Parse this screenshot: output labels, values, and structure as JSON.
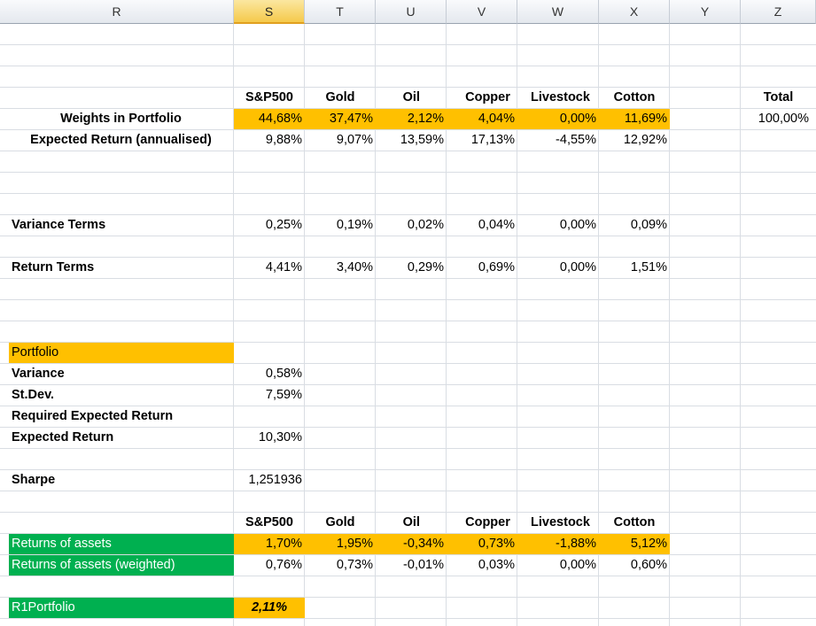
{
  "columns": [
    "R",
    "S",
    "T",
    "U",
    "V",
    "W",
    "X",
    "Y",
    "Z"
  ],
  "selected_column": "S",
  "assets_header": [
    "S&P500",
    "Gold",
    "Oil",
    "Copper",
    "Livestock",
    "Cotton"
  ],
  "total_label": "Total",
  "weights": {
    "label": "Weights in Portfolio",
    "values": [
      "44,68%",
      "37,47%",
      "2,12%",
      "4,04%",
      "0,00%",
      "11,69%"
    ],
    "total": "100,00%"
  },
  "expected_return": {
    "label": "Expected Return (annualised)",
    "values": [
      "9,88%",
      "9,07%",
      "13,59%",
      "17,13%",
      "-4,55%",
      "12,92%"
    ]
  },
  "variance_terms": {
    "label": "Variance Terms",
    "values": [
      "0,25%",
      "0,19%",
      "0,02%",
      "0,04%",
      "0,00%",
      "0,09%"
    ]
  },
  "return_terms": {
    "label": "Return Terms",
    "values": [
      "4,41%",
      "3,40%",
      "0,29%",
      "0,69%",
      "0,00%",
      "1,51%"
    ]
  },
  "portfolio": {
    "title": "Portfolio",
    "variance_label": "Variance",
    "variance": "0,58%",
    "stdev_label": "St.Dev.",
    "stdev": "7,59%",
    "req_label": "Required Expected Return",
    "exp_label": "Expected Return",
    "exp": "10,30%"
  },
  "sharpe": {
    "label": "Sharpe",
    "value": "1,251936"
  },
  "assets_header_2": [
    "S&P500",
    "Gold",
    "Oil",
    "Copper",
    "Livestock",
    "Cotton"
  ],
  "returns_assets": {
    "label": "Returns of assets",
    "values": [
      "1,70%",
      "1,95%",
      "-0,34%",
      "0,73%",
      "-1,88%",
      "5,12%"
    ]
  },
  "returns_weighted": {
    "label": "Returns of assets (weighted)",
    "values": [
      "0,76%",
      "0,73%",
      "-0,01%",
      "0,03%",
      "0,00%",
      "0,60%"
    ]
  },
  "r1portfolio": {
    "label": "R1Portfolio",
    "value": "2,11%"
  },
  "colors": {
    "highlight_orange": "#ffc000",
    "highlight_green": "#00b050",
    "header_selected": "#f5c94b"
  }
}
